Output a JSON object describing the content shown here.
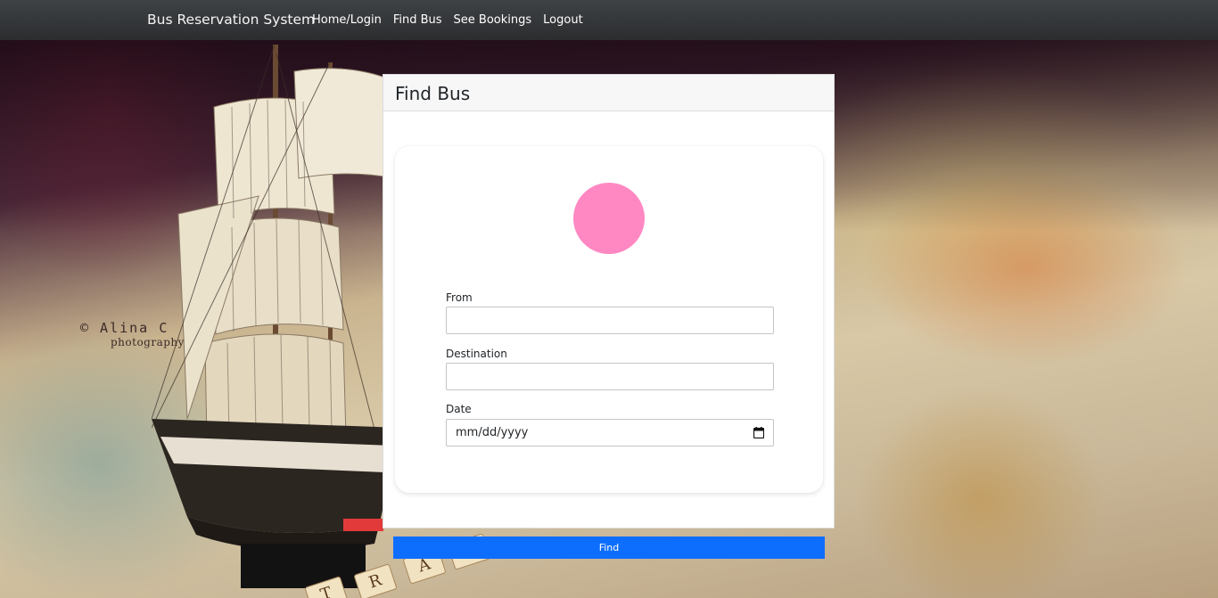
{
  "navbar": {
    "brand": "Bus Reservation System",
    "links": [
      {
        "label": "Home/Login"
      },
      {
        "label": "Find Bus"
      },
      {
        "label": "See Bookings"
      },
      {
        "label": "Logout"
      }
    ]
  },
  "background": {
    "watermark_line1": "© Alina C",
    "watermark_line2": "photography",
    "tiles": [
      "T",
      "R",
      "A",
      "V"
    ]
  },
  "find_bus": {
    "title": "Find Bus",
    "avatar_color": "#ff88c3",
    "from_label": "From",
    "from_value": "",
    "destination_label": "Destination",
    "destination_value": "",
    "date_label": "Date",
    "date_placeholder": "mm/dd/yyyy",
    "find_button_label": "Find"
  },
  "colors": {
    "navbar": "#2b2d2f",
    "button": "#0d6efd",
    "avatar": "#ff88c3"
  }
}
